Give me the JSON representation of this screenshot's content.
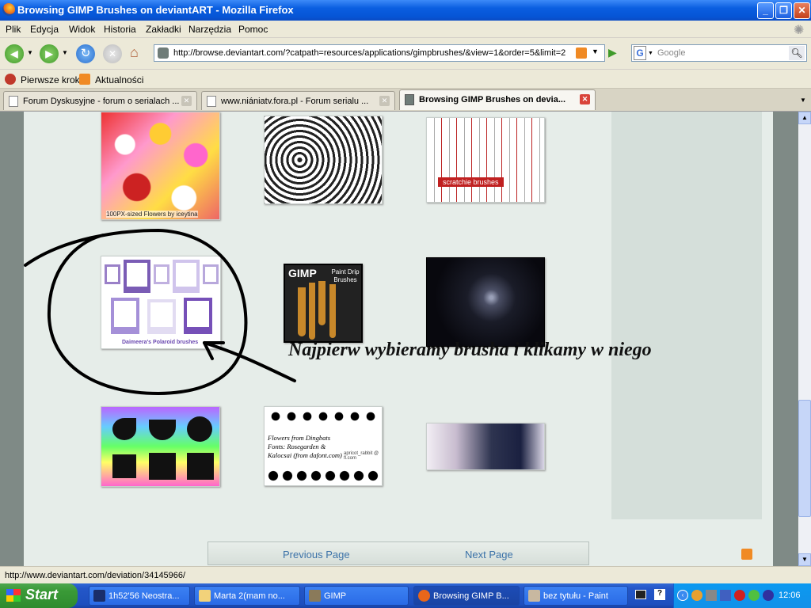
{
  "window": {
    "title": "Browsing GIMP Brushes on deviantART - Mozilla Firefox"
  },
  "menu": [
    "Plik",
    "Edycja",
    "Widok",
    "Historia",
    "Zakładki",
    "Narzędzia",
    "Pomoc"
  ],
  "nav": {
    "url": "http://browse.deviantart.com/?catpath=resources/applications/gimpbrushes/&view=1&order=5&limit=2",
    "search_engine": "G",
    "search_placeholder": "Google"
  },
  "bookmarks": [
    "Pierwsze kroki",
    "Aktualności"
  ],
  "tabs": [
    {
      "label": "Forum Dyskusyjne - forum o serialach ...",
      "active": false
    },
    {
      "label": "www.niániatv.fora.pl - Forum serialu ...",
      "active": false
    },
    {
      "label": "Browsing GIMP Brushes on devia...",
      "active": true
    }
  ],
  "thumbnails": {
    "flowers_caption": "100PX-sized Flowers by iceytina",
    "scratchie_caption": "scratchie brushes",
    "polaroid_caption": "Daimeera's Polaroid brushes",
    "gimp_label": "GIMP",
    "paint_drip_label": "Paint Drip Brushes",
    "dingbats_text": "Flowers from Dingbats Fonts: Rosegarden & Kalocsai (from dafont.com)",
    "dingbats_author": "apricot_rabbit @ fl.com"
  },
  "annotation": "Najpierw wybieramy brusha i klikamy w niego",
  "pager": {
    "previous": "Previous Page",
    "next": "Next Page"
  },
  "status": {
    "text": "http://www.deviantart.com/deviation/34145966/"
  },
  "taskbar": {
    "start": "Start",
    "buttons": [
      "1h52'56 Neostra...",
      "Marta 2(mam no...",
      "GIMP",
      "Browsing GIMP B...",
      "bez tytułu - Paint"
    ],
    "clock": "12:06"
  }
}
